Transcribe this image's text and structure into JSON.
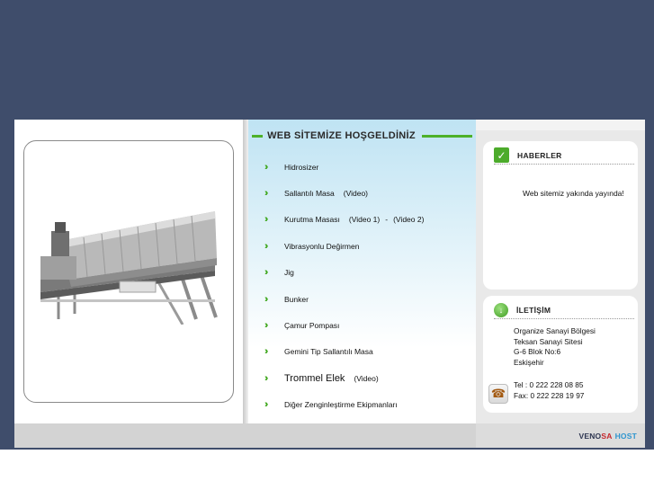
{
  "welcome_title": "WEB SİTEMİZE HOŞGELDİNİZ",
  "photo": {
    "alt": "machine-photo"
  },
  "menu": [
    {
      "label": "Hidrosizer",
      "video": "",
      "video2": "",
      "sep": ""
    },
    {
      "label": "Sallantılı Masa",
      "video": "(Video)",
      "video2": "",
      "sep": ""
    },
    {
      "label": "Kurutma Masası",
      "video": "(Video 1)",
      "video2": "(Video 2)",
      "sep": "-"
    },
    {
      "label": "Vibrasyonlu Değirmen",
      "video": "",
      "video2": "",
      "sep": ""
    },
    {
      "label": "Jig",
      "video": "",
      "video2": "",
      "sep": ""
    },
    {
      "label": "Bunker",
      "video": "",
      "video2": "",
      "sep": ""
    },
    {
      "label": "Çamur Pompası",
      "video": "",
      "video2": "",
      "sep": ""
    },
    {
      "label": "Gemini Tip Sallantılı Masa",
      "video": "",
      "video2": "",
      "sep": ""
    },
    {
      "label": "Trommel Elek",
      "video": "(Video)",
      "video2": "",
      "sep": ""
    },
    {
      "label": "Diğer Zenginleştirme Ekipmanları",
      "video": "",
      "video2": "",
      "sep": ""
    }
  ],
  "news": {
    "title": "HABERLER",
    "text": "Web sitemiz yakında yayında!"
  },
  "contact": {
    "title": "İLETİŞİM",
    "address": [
      "Organize Sanayi Bölgesi",
      "Teksan Sanayi Sitesi",
      "G-6 Blok No:6",
      "Eskişehir"
    ],
    "tel": "Tel : 0 222 228 08 85",
    "fax": "Fax: 0 222 228 19 97"
  },
  "footer": {
    "brand_part1": "VENO",
    "brand_part2": "SA",
    "brand_part3": "HOST"
  },
  "colors": {
    "background": "#3f4d6b",
    "accent_green": "#4db12a",
    "brand_red": "#c5262c",
    "brand_blue": "#2e95cf"
  },
  "icons": {
    "menu_bullet": "double-chevron-right-icon",
    "news": "check-icon",
    "contact": "globe-download-icon",
    "phone": "phone-icon"
  }
}
